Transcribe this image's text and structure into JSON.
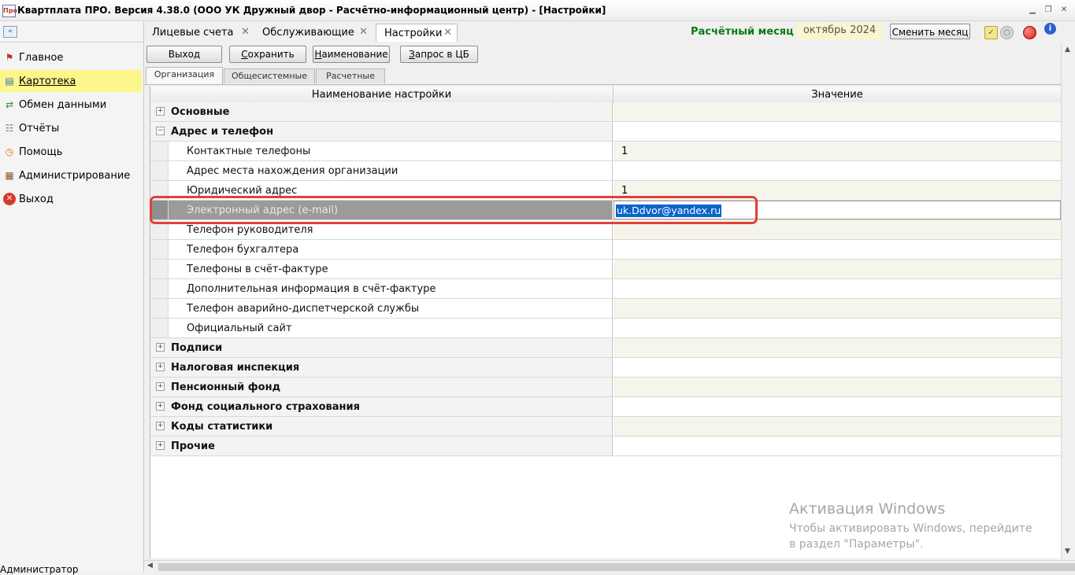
{
  "window": {
    "title": "Квартплата ПРО.  Версия 4.38.0 (ООО УК Дружный двор - Расчётно-информационный центр) - [Настройки]",
    "logo_text": "Про"
  },
  "sidebar": {
    "items": [
      {
        "label": "Главное",
        "icon": "flag-icon"
      },
      {
        "label": "Картотека",
        "icon": "card-index-icon"
      },
      {
        "label": "Обмен данными",
        "icon": "data-exchange-icon"
      },
      {
        "label": "Отчёты",
        "icon": "reports-icon"
      },
      {
        "label": "Помощь",
        "icon": "help-icon"
      },
      {
        "label": "Администрирование",
        "icon": "admin-icon"
      },
      {
        "label": "Выход",
        "icon": "exit-icon"
      }
    ],
    "footer_user": "Администратор"
  },
  "doc_tabs": [
    {
      "label": "Лицевые счета"
    },
    {
      "label": "Обслуживающие"
    },
    {
      "label": "Настройки"
    }
  ],
  "month": {
    "label": "Расчётный месяц",
    "value": "октябрь 2024",
    "change_button": "Сменить месяц"
  },
  "toolbar": {
    "exit": "Выход",
    "save_first": "С",
    "save_rest": "охранить",
    "naming_first": "Н",
    "naming_rest": "аименование",
    "request_first": "З",
    "request_rest": "апрос в ЦБ"
  },
  "sub_tabs": [
    {
      "label": "Организация"
    },
    {
      "label": "Общесистемные"
    },
    {
      "label": "Расчетные"
    }
  ],
  "grid": {
    "headers": {
      "name": "Наименование настройки",
      "value": "Значение"
    },
    "rows": [
      {
        "type": "group",
        "expand": "+",
        "label": "Основные",
        "value": ""
      },
      {
        "type": "group",
        "expand": "−",
        "label": "Адрес и телефон",
        "value": ""
      },
      {
        "type": "child",
        "label": "Контактные телефоны",
        "value": "1"
      },
      {
        "type": "child",
        "label": "Адрес места нахождения организации",
        "value": ""
      },
      {
        "type": "child",
        "label": "Юридический адрес",
        "value": "1"
      },
      {
        "type": "child",
        "label": "Электронный адрес (e-mail)",
        "value": "uk.Ddvor@yandex.ru"
      },
      {
        "type": "child",
        "label": "Телефон руководителя",
        "value": ""
      },
      {
        "type": "child",
        "label": "Телефон бухгалтера",
        "value": ""
      },
      {
        "type": "child",
        "label": "Телефоны в счёт-фактуре",
        "value": ""
      },
      {
        "type": "child",
        "label": "Дополнительная информация в счёт-фактуре",
        "value": ""
      },
      {
        "type": "child",
        "label": "Телефон аварийно-диспетчерской службы",
        "value": ""
      },
      {
        "type": "child",
        "label": "Официальный сайт",
        "value": ""
      },
      {
        "type": "group",
        "expand": "+",
        "label": "Подписи",
        "value": ""
      },
      {
        "type": "group",
        "expand": "+",
        "label": "Налоговая инспекция",
        "value": ""
      },
      {
        "type": "group",
        "expand": "+",
        "label": "Пенсионный фонд",
        "value": ""
      },
      {
        "type": "group",
        "expand": "+",
        "label": "Фонд социального страхования",
        "value": ""
      },
      {
        "type": "group",
        "expand": "+",
        "label": "Коды статистики",
        "value": ""
      },
      {
        "type": "group",
        "expand": "+",
        "label": "Прочие",
        "value": ""
      }
    ]
  },
  "watermark": {
    "line1": "Активация Windows",
    "line2": "Чтобы активировать Windows, перейдите в раздел \"Параметры\"."
  },
  "colors": {
    "active_sidebar": "#fdf68a",
    "month_label": "#0b7a12",
    "highlight_border": "#e0403a",
    "selection": "#0a64c9"
  }
}
